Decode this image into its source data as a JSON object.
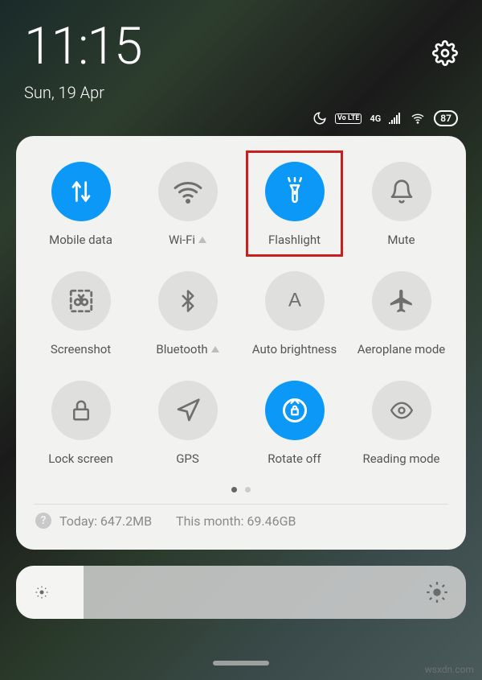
{
  "status": {
    "time": "11:15",
    "date": "Sun, 19 Apr",
    "dnd": true,
    "volte": "Vo LTE",
    "network": "4G",
    "wifi": true,
    "battery": "87"
  },
  "tiles": [
    {
      "id": "mobile-data",
      "label": "Mobile data",
      "active": true,
      "icon": "arrows",
      "caret": false,
      "highlight": false
    },
    {
      "id": "wifi",
      "label": "Wi-Fi",
      "active": false,
      "icon": "wifi",
      "caret": true,
      "highlight": false
    },
    {
      "id": "flashlight",
      "label": "Flashlight",
      "active": true,
      "icon": "flashlight",
      "caret": false,
      "highlight": true
    },
    {
      "id": "mute",
      "label": "Mute",
      "active": false,
      "icon": "bell",
      "caret": false,
      "highlight": false
    },
    {
      "id": "screenshot",
      "label": "Screenshot",
      "active": false,
      "icon": "screenshot",
      "caret": false,
      "highlight": false
    },
    {
      "id": "bluetooth",
      "label": "Bluetooth",
      "active": false,
      "icon": "bluetooth",
      "caret": true,
      "highlight": false
    },
    {
      "id": "auto-brightness",
      "label": "Auto brightness",
      "active": false,
      "icon": "brightness-a",
      "caret": false,
      "highlight": false
    },
    {
      "id": "aeroplane-mode",
      "label": "Aeroplane mode",
      "active": false,
      "icon": "plane",
      "caret": false,
      "highlight": false
    },
    {
      "id": "lock-screen",
      "label": "Lock screen",
      "active": false,
      "icon": "lock",
      "caret": false,
      "highlight": false
    },
    {
      "id": "gps",
      "label": "GPS",
      "active": false,
      "icon": "gps",
      "caret": false,
      "highlight": false
    },
    {
      "id": "rotate-off",
      "label": "Rotate off",
      "active": true,
      "icon": "rotate-lock",
      "caret": false,
      "highlight": false
    },
    {
      "id": "reading-mode",
      "label": "Reading mode",
      "active": false,
      "icon": "eye",
      "caret": false,
      "highlight": false
    }
  ],
  "pages": {
    "count": 2,
    "active": 0
  },
  "usage": {
    "today_label": "Today:",
    "today_value": "647.2MB",
    "month_label": "This month:",
    "month_value": "69.46GB"
  },
  "brightness": {
    "level_percent": 15
  },
  "watermark": "wsxdn.com",
  "colors": {
    "accent": "#0b98f6",
    "highlight": "#c7201f",
    "tile_off": "#dfdfde"
  }
}
